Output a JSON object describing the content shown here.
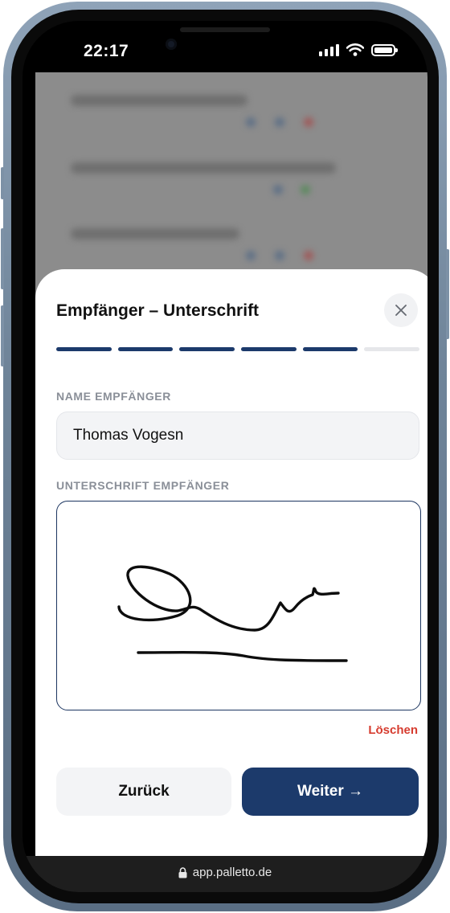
{
  "status_bar": {
    "time": "22:17"
  },
  "sheet": {
    "title": "Empfänger – Unterschrift",
    "progress": {
      "total_steps": 6,
      "completed_steps": 5,
      "active_color": "#1c3a6b",
      "inactive_color": "#e6e7ea"
    },
    "name_field": {
      "label": "NAME EMPFÄNGER",
      "value": "Thomas Vogesn"
    },
    "signature_field": {
      "label": "UNTERSCHRIFT EMPFÄNGER",
      "clear_label": "Löschen"
    },
    "buttons": {
      "back_label": "Zurück",
      "next_label": "Weiter →"
    }
  },
  "browser": {
    "url": "app.palletto.de"
  },
  "colors": {
    "accent": "#1c3a6b",
    "danger": "#d63c2f",
    "field_bg": "#f3f4f6"
  },
  "icons": {
    "close": "close-icon",
    "lock": "lock-icon",
    "signal": "cellular-signal-icon",
    "wifi": "wifi-icon",
    "battery": "battery-icon"
  }
}
